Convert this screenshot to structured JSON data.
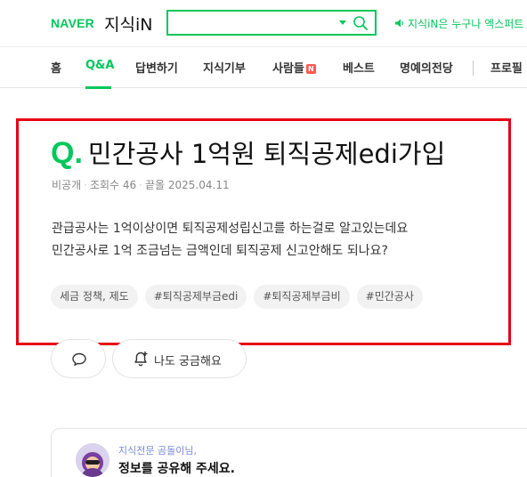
{
  "header": {
    "naver_logo": "NAVER",
    "service_logo": "지식iN",
    "search": {
      "value": "",
      "placeholder": ""
    },
    "notice": "지식iN은 누구나 엑스퍼트"
  },
  "nav": {
    "items": [
      {
        "label": "홈",
        "active": false
      },
      {
        "label": "Q&A",
        "active": true
      },
      {
        "label": "답변하기",
        "active": false
      },
      {
        "label": "지식기부",
        "active": false
      },
      {
        "label": "사람들",
        "active": false,
        "badge": "N"
      },
      {
        "label": "베스트",
        "active": false
      },
      {
        "label": "명예의전당",
        "active": false
      },
      {
        "label": "프로필",
        "active": false
      }
    ]
  },
  "question": {
    "mark": "Q.",
    "title": "민간공사 1억원 퇴직공제edi가입",
    "meta": {
      "visibility": "비공개",
      "views": "조회수 46",
      "date": "끝올 2025.04.11"
    },
    "body": [
      "관급공사는 1억이상이면 퇴직공제성립신고를 하는걸로 알고있는데요",
      "민간공사로 1억 조금넘는 금액인데 퇴직공제 신고안해도 되나요?"
    ],
    "tags": [
      "세금 정책, 제도",
      "#퇴직공제부금edi",
      "#퇴직공제부금비",
      "#민간공사"
    ]
  },
  "actions": {
    "curious_label": "나도 궁금해요"
  },
  "expert": {
    "subtitle": "지식전문 곰돌이님,",
    "message": "정보를 공유해 주세요."
  },
  "colors": {
    "brand": "#03c75a",
    "highlight": "#e60012"
  }
}
